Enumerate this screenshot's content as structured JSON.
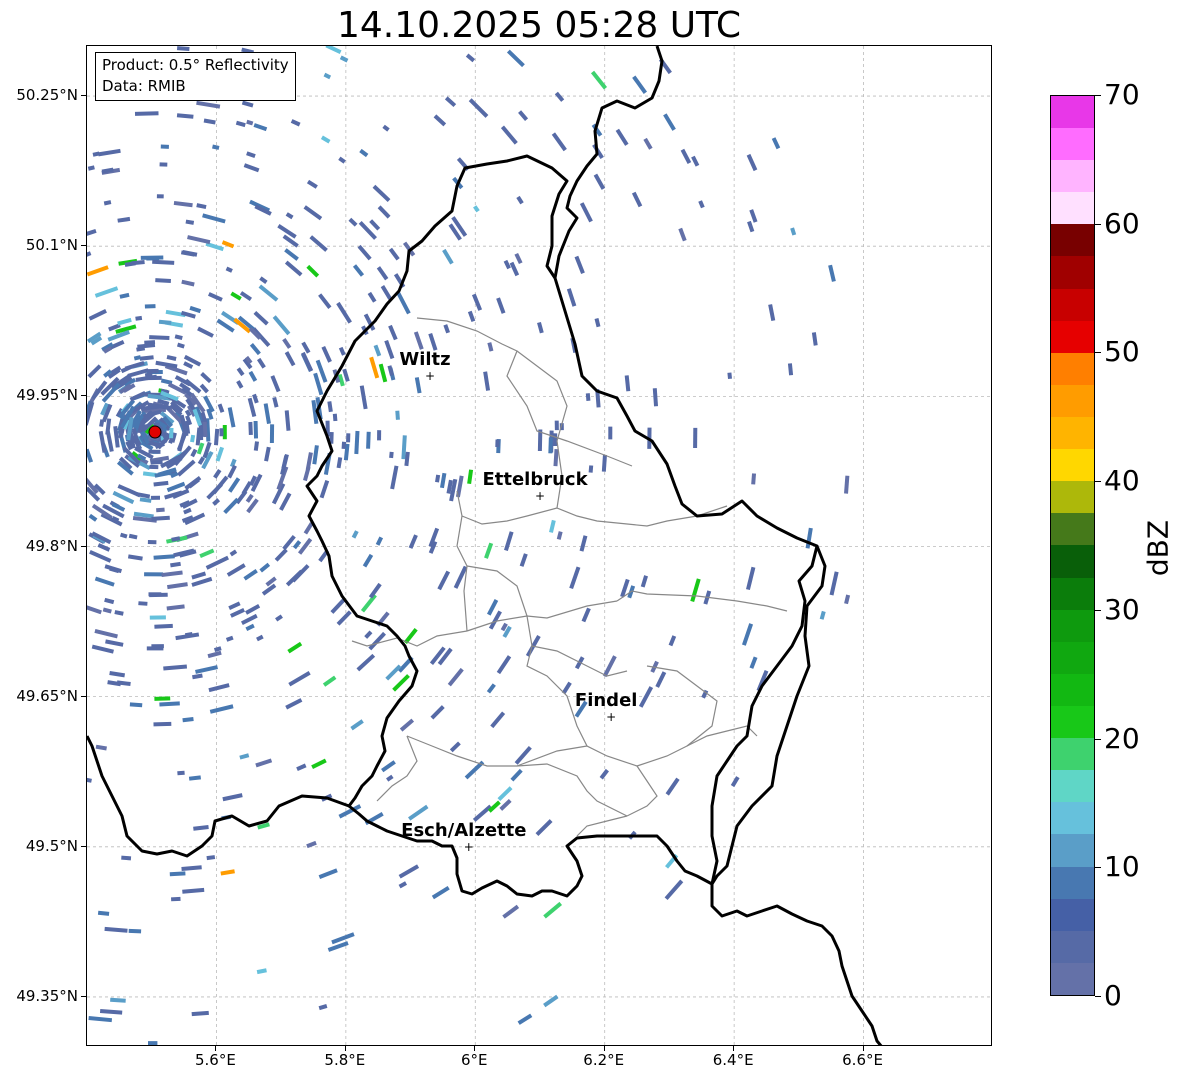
{
  "title": "14.10.2025 05:28 UTC",
  "info_box": {
    "product": "Product: 0.5° Reflectivity",
    "source": "Data: RMIB"
  },
  "map": {
    "extent": {
      "lon_min": 5.4,
      "lon_max": 6.8,
      "lat_min": 49.3,
      "lat_max": 50.3
    },
    "lat_ticks": [
      {
        "lat": 50.25,
        "label": "50.25°N"
      },
      {
        "lat": 50.1,
        "label": "50.1°N"
      },
      {
        "lat": 49.95,
        "label": "49.95°N"
      },
      {
        "lat": 49.8,
        "label": "49.8°N"
      },
      {
        "lat": 49.65,
        "label": "49.65°N"
      },
      {
        "lat": 49.5,
        "label": "49.5°N"
      },
      {
        "lat": 49.35,
        "label": "49.35°N"
      }
    ],
    "lon_ticks": [
      {
        "lon": 5.6,
        "label": "5.6°E"
      },
      {
        "lon": 5.8,
        "label": "5.8°E"
      },
      {
        "lon": 6.0,
        "label": "6°E"
      },
      {
        "lon": 6.2,
        "label": "6.2°E"
      },
      {
        "lon": 6.4,
        "label": "6.4°E"
      },
      {
        "lon": 6.6,
        "label": "6.6°E"
      }
    ],
    "cities": [
      {
        "name": "Wiltz",
        "lon": 5.93,
        "lat": 49.97
      },
      {
        "name": "Ettelbruck",
        "lon": 6.1,
        "lat": 49.85
      },
      {
        "name": "Findel",
        "lon": 6.21,
        "lat": 49.63
      },
      {
        "name": "Esch/Alzette",
        "lon": 5.99,
        "lat": 49.5
      }
    ],
    "radar_site": {
      "lon": 5.505,
      "lat": 49.914
    },
    "borders_color": "#000000",
    "cantons_color": "#888888",
    "grid_color": "#bbbbbb"
  },
  "colorbar": {
    "unit": "dBZ",
    "min": 0,
    "max": 70,
    "step": 2.5,
    "tick_labels": [
      "0",
      "10",
      "20",
      "30",
      "40",
      "50",
      "60",
      "70"
    ],
    "colors": [
      "#6471a8",
      "#566aa6",
      "#4560a6",
      "#4878b1",
      "#5a9ec8",
      "#66c1dc",
      "#5fd6c6",
      "#3ed26e",
      "#18c818",
      "#12b812",
      "#10a810",
      "#0e9a0e",
      "#0b7d0b",
      "#095f09",
      "#45791a",
      "#adb80a",
      "#ffd700",
      "#ffb400",
      "#ff9c00",
      "#ff7f00",
      "#e60000",
      "#c80000",
      "#a00000",
      "#780000",
      "#ffe0ff",
      "#ffb4ff",
      "#ff6cff",
      "#e837e8"
    ]
  }
}
